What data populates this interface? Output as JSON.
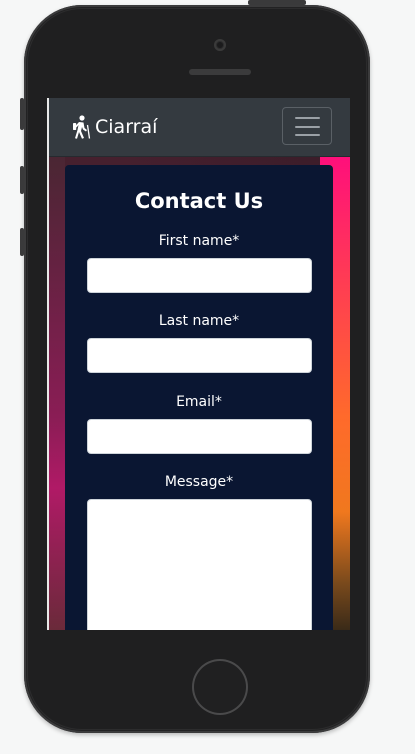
{
  "navbar": {
    "brand_text": "Ciarraí",
    "brand_icon": "hiking-icon",
    "toggler_icon": "hamburger-menu-icon"
  },
  "contact_form": {
    "title": "Contact Us",
    "fields": [
      {
        "label": "First name*",
        "value": "",
        "type": "text"
      },
      {
        "label": "Last name*",
        "value": "",
        "type": "text"
      },
      {
        "label": "Email*",
        "value": "",
        "type": "email"
      },
      {
        "label": "Message*",
        "value": "",
        "type": "textarea"
      }
    ]
  },
  "colors": {
    "navbar_bg": "#343a40",
    "card_bg": "#0a1632",
    "accent_gradient_top": "#ff0f7b",
    "accent_gradient_mid": "#ff6a2b",
    "phone_body": "#222223"
  }
}
